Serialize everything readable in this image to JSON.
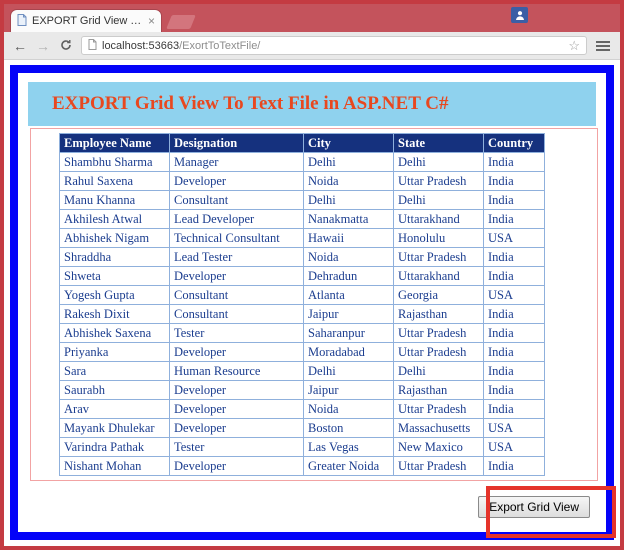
{
  "browser": {
    "tab": {
      "title": "EXPORT Grid View To a Te",
      "close": "×"
    },
    "url": {
      "host": "localhost:53663",
      "path": "/ExortToTextFile/"
    },
    "icons": {
      "back": "←",
      "forward": "→",
      "star": "☆"
    }
  },
  "page": {
    "heading": "EXPORT Grid View To Text File in ASP.NET C#",
    "export_button": "Export Grid View"
  },
  "grid": {
    "headers": [
      "Employee Name",
      "Designation",
      "City",
      "State",
      "Country"
    ],
    "rows": [
      [
        "Shambhu Sharma",
        "Manager",
        "Delhi",
        "Delhi",
        "India"
      ],
      [
        "Rahul Saxena",
        "Developer",
        "Noida",
        "Uttar Pradesh",
        "India"
      ],
      [
        "Manu Khanna",
        "Consultant",
        "Delhi",
        "Delhi",
        "India"
      ],
      [
        "Akhilesh Atwal",
        "Lead Developer",
        "Nanakmatta",
        "Uttarakhand",
        "India"
      ],
      [
        "Abhishek Nigam",
        "Technical Consultant",
        "Hawaii",
        "Honolulu",
        "USA"
      ],
      [
        "Shraddha",
        "Lead Tester",
        "Noida",
        "Uttar Pradesh",
        "India"
      ],
      [
        "Shweta",
        "Developer",
        "Dehradun",
        "Uttarakhand",
        "India"
      ],
      [
        "Yogesh Gupta",
        "Consultant",
        "Atlanta",
        "Georgia",
        "USA"
      ],
      [
        "Rakesh Dixit",
        "Consultant",
        "Jaipur",
        "Rajasthan",
        "India"
      ],
      [
        "Abhishek Saxena",
        "Tester",
        "Saharanpur",
        "Uttar Pradesh",
        "India"
      ],
      [
        "Priyanka",
        "Developer",
        "Moradabad",
        "Uttar Pradesh",
        "India"
      ],
      [
        "Sara",
        "Human Resource",
        "Delhi",
        "Delhi",
        "India"
      ],
      [
        "Saurabh",
        "Developer",
        "Jaipur",
        "Rajasthan",
        "India"
      ],
      [
        "Arav",
        "Developer",
        "Noida",
        "Uttar Pradesh",
        "India"
      ],
      [
        "Mayank Dhulekar",
        "Developer",
        "Boston",
        "Massachusetts",
        "USA"
      ],
      [
        "Varindra Pathak",
        "Tester",
        "Las Vegas",
        "New Maxico",
        "USA"
      ],
      [
        "Nishant Mohan",
        "Developer",
        "Greater Noida",
        "Uttar Pradesh",
        "India"
      ]
    ]
  },
  "colors": {
    "theme_red": "#c4535c",
    "frame_blue": "#0403f8",
    "band_blue": "#8fd2ee",
    "heading_orange": "#e8481f",
    "grid_header_bg": "#15317e",
    "grid_text": "#1b3d8f",
    "annotation_red": "#e5332a"
  }
}
